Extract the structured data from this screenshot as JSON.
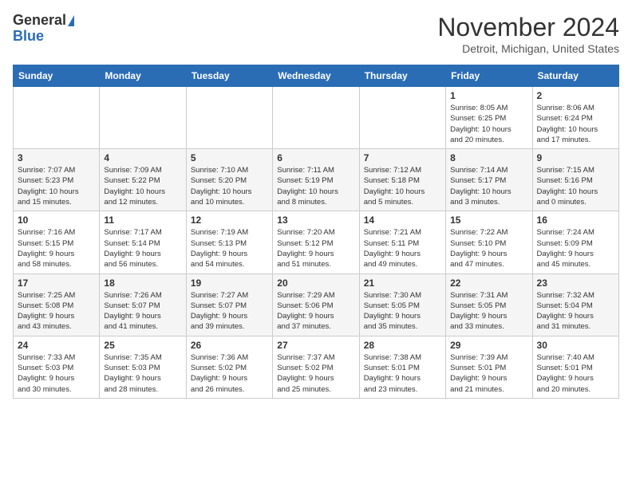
{
  "header": {
    "logo_general": "General",
    "logo_blue": "Blue",
    "month_year": "November 2024",
    "location": "Detroit, Michigan, United States"
  },
  "days_of_week": [
    "Sunday",
    "Monday",
    "Tuesday",
    "Wednesday",
    "Thursday",
    "Friday",
    "Saturday"
  ],
  "weeks": [
    [
      {
        "day": "",
        "info": ""
      },
      {
        "day": "",
        "info": ""
      },
      {
        "day": "",
        "info": ""
      },
      {
        "day": "",
        "info": ""
      },
      {
        "day": "",
        "info": ""
      },
      {
        "day": "1",
        "info": "Sunrise: 8:05 AM\nSunset: 6:25 PM\nDaylight: 10 hours\nand 20 minutes."
      },
      {
        "day": "2",
        "info": "Sunrise: 8:06 AM\nSunset: 6:24 PM\nDaylight: 10 hours\nand 17 minutes."
      }
    ],
    [
      {
        "day": "3",
        "info": "Sunrise: 7:07 AM\nSunset: 5:23 PM\nDaylight: 10 hours\nand 15 minutes."
      },
      {
        "day": "4",
        "info": "Sunrise: 7:09 AM\nSunset: 5:22 PM\nDaylight: 10 hours\nand 12 minutes."
      },
      {
        "day": "5",
        "info": "Sunrise: 7:10 AM\nSunset: 5:20 PM\nDaylight: 10 hours\nand 10 minutes."
      },
      {
        "day": "6",
        "info": "Sunrise: 7:11 AM\nSunset: 5:19 PM\nDaylight: 10 hours\nand 8 minutes."
      },
      {
        "day": "7",
        "info": "Sunrise: 7:12 AM\nSunset: 5:18 PM\nDaylight: 10 hours\nand 5 minutes."
      },
      {
        "day": "8",
        "info": "Sunrise: 7:14 AM\nSunset: 5:17 PM\nDaylight: 10 hours\nand 3 minutes."
      },
      {
        "day": "9",
        "info": "Sunrise: 7:15 AM\nSunset: 5:16 PM\nDaylight: 10 hours\nand 0 minutes."
      }
    ],
    [
      {
        "day": "10",
        "info": "Sunrise: 7:16 AM\nSunset: 5:15 PM\nDaylight: 9 hours\nand 58 minutes."
      },
      {
        "day": "11",
        "info": "Sunrise: 7:17 AM\nSunset: 5:14 PM\nDaylight: 9 hours\nand 56 minutes."
      },
      {
        "day": "12",
        "info": "Sunrise: 7:19 AM\nSunset: 5:13 PM\nDaylight: 9 hours\nand 54 minutes."
      },
      {
        "day": "13",
        "info": "Sunrise: 7:20 AM\nSunset: 5:12 PM\nDaylight: 9 hours\nand 51 minutes."
      },
      {
        "day": "14",
        "info": "Sunrise: 7:21 AM\nSunset: 5:11 PM\nDaylight: 9 hours\nand 49 minutes."
      },
      {
        "day": "15",
        "info": "Sunrise: 7:22 AM\nSunset: 5:10 PM\nDaylight: 9 hours\nand 47 minutes."
      },
      {
        "day": "16",
        "info": "Sunrise: 7:24 AM\nSunset: 5:09 PM\nDaylight: 9 hours\nand 45 minutes."
      }
    ],
    [
      {
        "day": "17",
        "info": "Sunrise: 7:25 AM\nSunset: 5:08 PM\nDaylight: 9 hours\nand 43 minutes."
      },
      {
        "day": "18",
        "info": "Sunrise: 7:26 AM\nSunset: 5:07 PM\nDaylight: 9 hours\nand 41 minutes."
      },
      {
        "day": "19",
        "info": "Sunrise: 7:27 AM\nSunset: 5:07 PM\nDaylight: 9 hours\nand 39 minutes."
      },
      {
        "day": "20",
        "info": "Sunrise: 7:29 AM\nSunset: 5:06 PM\nDaylight: 9 hours\nand 37 minutes."
      },
      {
        "day": "21",
        "info": "Sunrise: 7:30 AM\nSunset: 5:05 PM\nDaylight: 9 hours\nand 35 minutes."
      },
      {
        "day": "22",
        "info": "Sunrise: 7:31 AM\nSunset: 5:05 PM\nDaylight: 9 hours\nand 33 minutes."
      },
      {
        "day": "23",
        "info": "Sunrise: 7:32 AM\nSunset: 5:04 PM\nDaylight: 9 hours\nand 31 minutes."
      }
    ],
    [
      {
        "day": "24",
        "info": "Sunrise: 7:33 AM\nSunset: 5:03 PM\nDaylight: 9 hours\nand 30 minutes."
      },
      {
        "day": "25",
        "info": "Sunrise: 7:35 AM\nSunset: 5:03 PM\nDaylight: 9 hours\nand 28 minutes."
      },
      {
        "day": "26",
        "info": "Sunrise: 7:36 AM\nSunset: 5:02 PM\nDaylight: 9 hours\nand 26 minutes."
      },
      {
        "day": "27",
        "info": "Sunrise: 7:37 AM\nSunset: 5:02 PM\nDaylight: 9 hours\nand 25 minutes."
      },
      {
        "day": "28",
        "info": "Sunrise: 7:38 AM\nSunset: 5:01 PM\nDaylight: 9 hours\nand 23 minutes."
      },
      {
        "day": "29",
        "info": "Sunrise: 7:39 AM\nSunset: 5:01 PM\nDaylight: 9 hours\nand 21 minutes."
      },
      {
        "day": "30",
        "info": "Sunrise: 7:40 AM\nSunset: 5:01 PM\nDaylight: 9 hours\nand 20 minutes."
      }
    ]
  ]
}
